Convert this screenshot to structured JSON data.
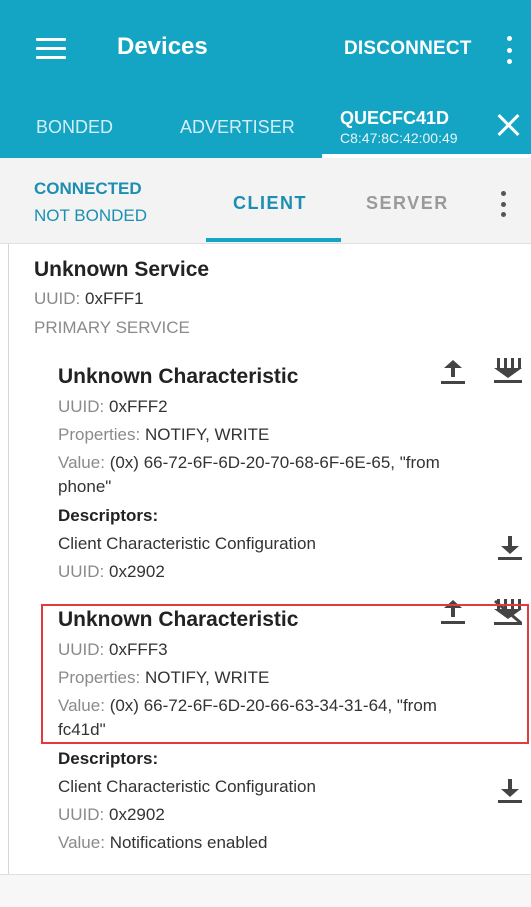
{
  "appbar": {
    "title": "Devices",
    "disconnect_label": "DISCONNECT"
  },
  "tabs": {
    "bonded": "BONDED",
    "advertiser": "ADVERTISER",
    "device_name": "QUECFC41D",
    "device_mac": "C8:47:8C:42:00:49"
  },
  "status": {
    "connection": "CONNECTED",
    "bond": "NOT BONDED"
  },
  "subtabs": {
    "client": "CLIENT",
    "server": "SERVER"
  },
  "service": {
    "name": "Unknown Service",
    "uuid_label": "UUID:",
    "uuid": "0xFFF1",
    "type": "PRIMARY SERVICE"
  },
  "characteristics": [
    {
      "name": "Unknown Characteristic",
      "uuid_label": "UUID:",
      "uuid": "0xFFF2",
      "properties_label": "Properties:",
      "properties": "NOTIFY, WRITE",
      "value_label": "Value:",
      "value_line1": "(0x) 66-72-6F-6D-20-70-68-6F-6E-65, \"from",
      "value_line2": "phone\"",
      "descriptors_label": "Descriptors:",
      "descriptor_name": "Client Characteristic Configuration",
      "descriptor_uuid_label": "UUID:",
      "descriptor_uuid": "0x2902"
    },
    {
      "name": "Unknown Characteristic",
      "uuid_label": "UUID:",
      "uuid": "0xFFF3",
      "properties_label": "Properties:",
      "properties": "NOTIFY, WRITE",
      "value_label": "Value:",
      "value_line1": "(0x) 66-72-6F-6D-20-66-63-34-31-64, \"from",
      "value_line2": "fc41d\"",
      "descriptors_label": "Descriptors:",
      "descriptor_name": "Client Characteristic Configuration",
      "descriptor_uuid_label": "UUID:",
      "descriptor_uuid": "0x2902",
      "descriptor_value_label": "Value:",
      "descriptor_value": "Notifications enabled"
    }
  ],
  "colors": {
    "primary": "#14a4c4",
    "accent_text": "#1b8fb2",
    "highlight": "#e23b3b"
  },
  "icons": [
    "menu-icon",
    "more-vert-icon",
    "close-icon",
    "upload-icon",
    "notify-enable-icon",
    "notify-disable-icon",
    "download-icon"
  ]
}
